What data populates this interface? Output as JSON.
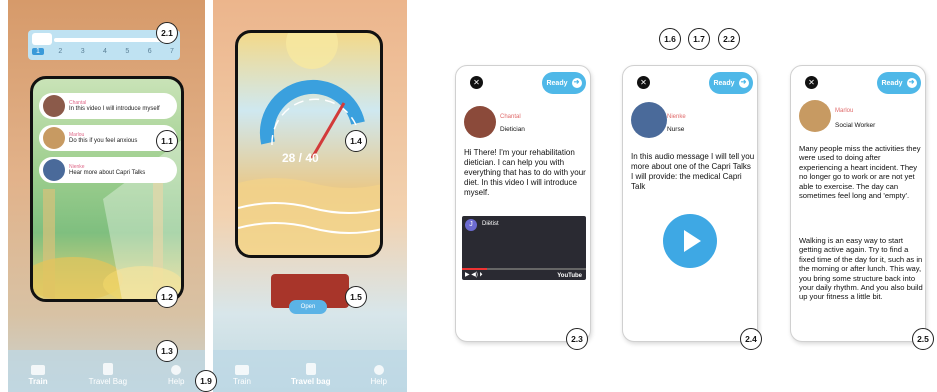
{
  "badges": {
    "b21": "2.1",
    "b11": "1.1",
    "b12": "1.2",
    "b13": "1.3",
    "b19": "1.9",
    "b14": "1.4",
    "b15": "1.5",
    "b16": "1.6",
    "b17": "1.7",
    "b22": "2.2",
    "b23": "2.3",
    "b24": "2.4",
    "b25": "2.5"
  },
  "train_screen": {
    "steps": [
      "1",
      "2",
      "3",
      "4",
      "5",
      "6",
      "7"
    ],
    "active_step": "1",
    "videos": [
      {
        "name": "Chantal",
        "text": "In this video I will introduce myself"
      },
      {
        "name": "Marlou",
        "text": "Do this if you feel anxious"
      },
      {
        "name": "Nienke",
        "text": "Hear more about Capri Talks"
      }
    ]
  },
  "tabbar_left": {
    "train": "Train",
    "travel_bag": "Travel Bag",
    "help": "Help"
  },
  "travel_screen": {
    "counter": "28 / 40",
    "open_label": "Open"
  },
  "tabbar_right": {
    "train": "Train",
    "travel_bag": "Travel bag",
    "help": "Help"
  },
  "colors": {
    "accent": "#4fb8e8",
    "bag": "#a8352a"
  },
  "cards": [
    {
      "close": "✕",
      "ready": "Ready",
      "arrow": "➜",
      "name": "Chantal",
      "role": "Dietician",
      "text": "Hi There! I'm your rehabilitation dietician. I can help you with everything that has to do with your diet. In this video I will introduce myself.",
      "video": {
        "initial": "J",
        "title": "Diëtist",
        "logo": "YouTube"
      }
    },
    {
      "close": "✕",
      "ready": "Ready",
      "arrow": "➜",
      "name": "Nienke",
      "role": "Nurse",
      "text": "In this audio message I will tell you more about one of the Capri Talks I will provide: the medical Capri Talk"
    },
    {
      "close": "✕",
      "ready": "Ready",
      "arrow": "➜",
      "name": "Marlou",
      "role": "Social Worker",
      "text": "Many people miss the activities they were used to doing after experiencing a heart incident. They no longer go to work or are not yet able to exercise. The day can sometimes feel long and 'empty'.",
      "text2": "Walking is an easy way to start getting active again. Try to find a fixed time of the day for it, such as in the morning or after lunch. This way, you bring some structure back into your daily rhythm. And you also build up your fitness a little bit."
    }
  ]
}
